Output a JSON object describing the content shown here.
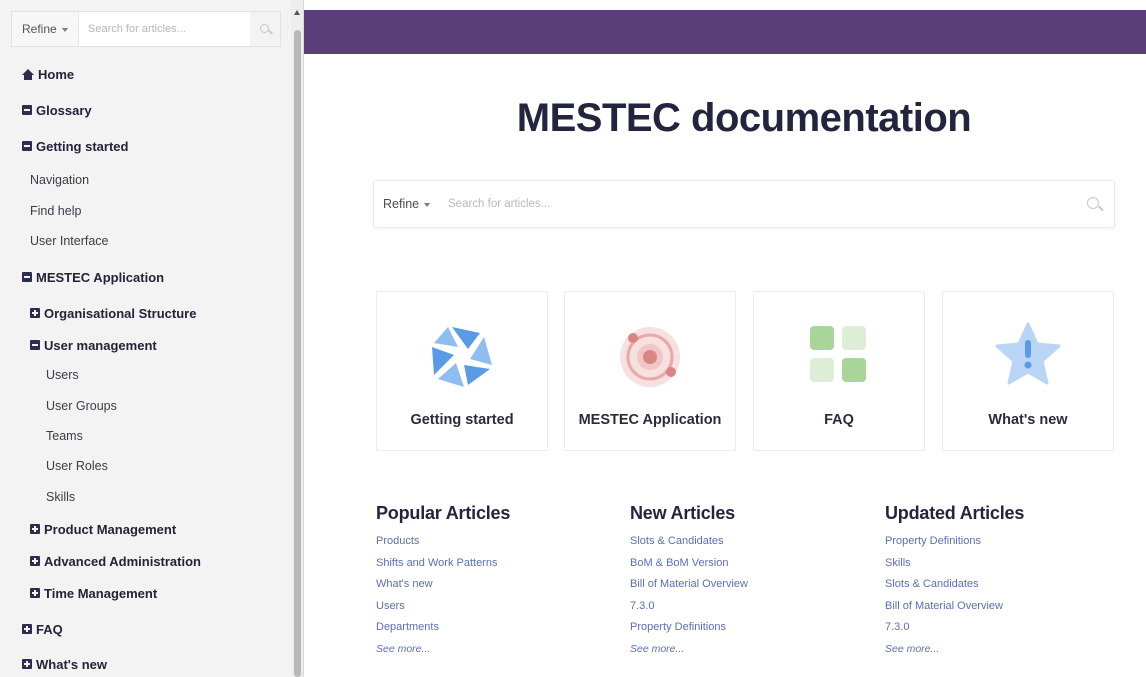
{
  "sidebar": {
    "search": {
      "refine_label": "Refine",
      "placeholder": "Search for articles..."
    },
    "items": [
      {
        "label": "Home",
        "icon": "home-icon"
      },
      {
        "label": "Glossary",
        "icon": "collapse-icon"
      },
      {
        "label": "Getting started",
        "icon": "collapse-icon"
      },
      {
        "label": "Navigation"
      },
      {
        "label": "Find help"
      },
      {
        "label": "User Interface"
      },
      {
        "label": "MESTEC Application",
        "icon": "collapse-icon"
      },
      {
        "label": "Organisational Structure",
        "icon": "expand-icon"
      },
      {
        "label": "User management",
        "icon": "collapse-icon"
      },
      {
        "label": "Users"
      },
      {
        "label": "User Groups"
      },
      {
        "label": "Teams"
      },
      {
        "label": "User Roles"
      },
      {
        "label": "Skills"
      },
      {
        "label": "Product Management",
        "icon": "expand-icon"
      },
      {
        "label": "Advanced Administration",
        "icon": "expand-icon"
      },
      {
        "label": "Time Management",
        "icon": "expand-icon"
      },
      {
        "label": "FAQ",
        "icon": "expand-icon"
      },
      {
        "label": "What's new",
        "icon": "expand-icon"
      }
    ]
  },
  "header": {
    "brand_color": "#5c3f7a"
  },
  "main": {
    "title": "MESTEC documentation",
    "search": {
      "refine_label": "Refine",
      "placeholder": "Search for articles..."
    },
    "cards": [
      {
        "label": "Getting started",
        "icon": "aperture-icon"
      },
      {
        "label": "MESTEC Application",
        "icon": "orbit-icon"
      },
      {
        "label": "FAQ",
        "icon": "grid-icon"
      },
      {
        "label": "What's new",
        "icon": "star-alert-icon"
      }
    ],
    "columns": [
      {
        "title": "Popular Articles",
        "links": [
          "Products",
          "Shifts and Work Patterns",
          "What's new",
          "Users",
          "Departments"
        ],
        "more": "See more..."
      },
      {
        "title": "New Articles",
        "links": [
          "Slots & Candidates",
          "BoM & BoM Version",
          "Bill of Material Overview",
          "7.3.0",
          "Property Definitions"
        ],
        "more": "See more..."
      },
      {
        "title": "Updated Articles",
        "links": [
          "Property Definitions",
          "Skills",
          "Slots & Candidates",
          "Bill of Material Overview",
          "7.3.0"
        ],
        "more": "See more..."
      }
    ]
  }
}
